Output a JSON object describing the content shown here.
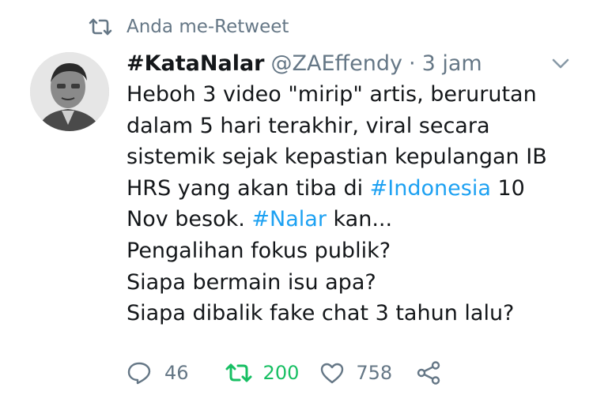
{
  "retweet_notice": {
    "icon": "retweet-icon",
    "text": "Anda me-Retweet"
  },
  "tweet": {
    "display_name": "#KataNalar",
    "handle": "@ZAEffendy",
    "separator": "·",
    "time": "3 jam",
    "body": {
      "line1": "Heboh 3 video \"mirip\" artis, berurutan",
      "line2": "dalam 5 hari terakhir, viral secara",
      "line3": "sistemik sejak kepastian kepulangan IB",
      "line4_pre": "HRS yang akan tiba di ",
      "line4_tag": "#Indonesia",
      "line4_post": " 10",
      "line5_pre": "Nov besok. ",
      "line5_tag": "#Nalar",
      "line5_post": " kan...",
      "line6": "Pengalihan fokus publik?",
      "line7": "Siapa bermain isu apa?",
      "line8": "Siapa dibalik fake chat 3 tahun lalu?"
    },
    "actions": {
      "reply_count": "46",
      "retweet_count": "200",
      "like_count": "758"
    }
  },
  "colors": {
    "text": "#14171a",
    "secondary": "#657786",
    "link": "#1da1f2",
    "retweet_active": "#17bf63"
  }
}
